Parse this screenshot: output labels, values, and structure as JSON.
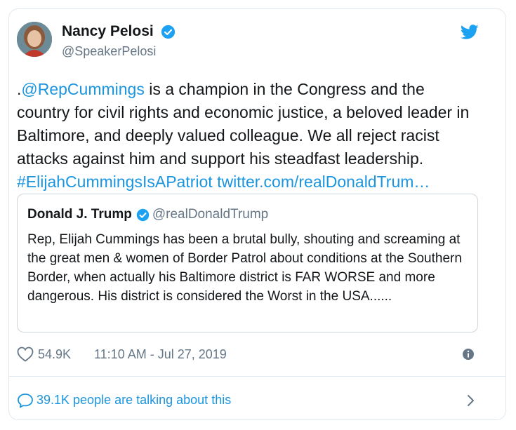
{
  "author": {
    "name": "Nancy Pelosi",
    "handle": "@SpeakerPelosi",
    "verified": true
  },
  "tweet": {
    "prefix": ".",
    "mention": "@RepCummings",
    "body": " is a champion in the Congress and the country for civil rights and economic justice, a beloved leader in Baltimore, and deeply valued colleague. We all reject racist attacks against him and support his steadfast leadership.",
    "hashtag": "#ElijahCummingsIsAPatriot",
    "link": "twitter.com/realDonaldTrum…"
  },
  "quoted": {
    "name": "Donald J. Trump",
    "handle": "@realDonaldTrump",
    "text": "Rep, Elijah Cummings has been a brutal bully, shouting and screaming at the great men & women of Border Patrol about conditions at the Southern Border, when actually his Baltimore district is FAR WORSE and more dangerous. His district is considered the Worst in the USA......"
  },
  "meta": {
    "likes": "54.9K",
    "timestamp": "11:10 AM - Jul 27, 2019"
  },
  "footer": {
    "talking": "39.1K people are talking about this"
  },
  "colors": {
    "link": "#1b95e0",
    "text": "#14171a",
    "muted": "#657786",
    "border": "#e1e8ed"
  },
  "icons": [
    "verified-badge-icon",
    "twitter-bird-icon",
    "heart-icon",
    "info-icon",
    "speech-bubble-icon",
    "chevron-right-icon"
  ]
}
